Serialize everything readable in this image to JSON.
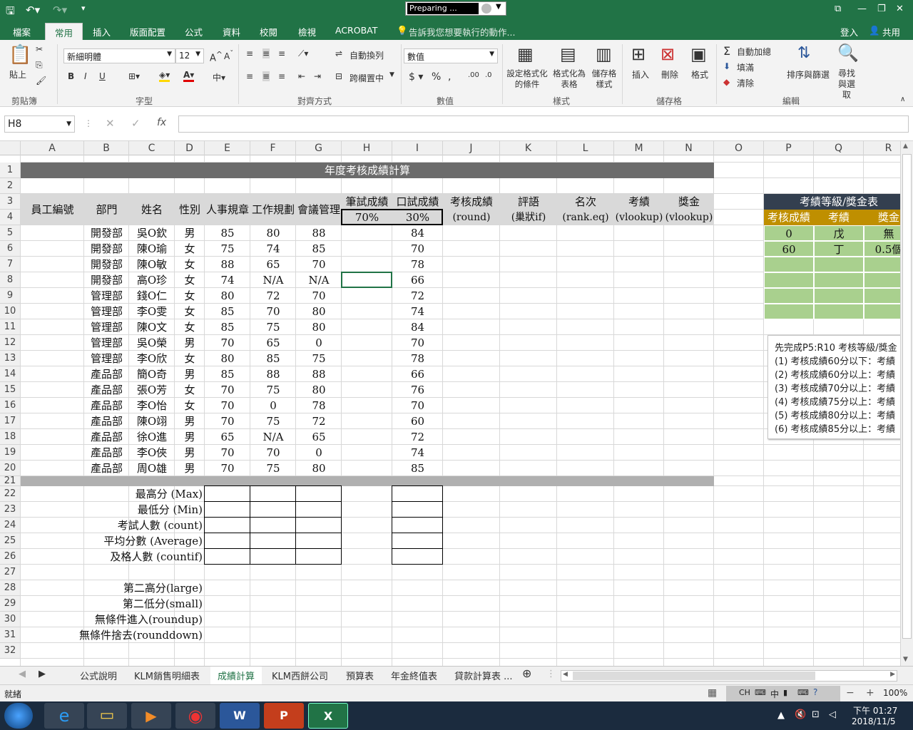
{
  "title_bar": {
    "preparing_text": "Preparing ...",
    "undo_icon": "undo-icon",
    "redo_icon": "redo-icon"
  },
  "ribbon_tabs": [
    "檔案",
    "常用",
    "插入",
    "版面配置",
    "公式",
    "資料",
    "校閱",
    "檢視",
    "ACROBAT"
  ],
  "tell_me": "告訴我您想要執行的動作...",
  "sign_in": "登入",
  "share": "共用",
  "ribbon": {
    "clipboard": {
      "paste": "貼上",
      "group": "剪貼簿"
    },
    "font": {
      "name": "新細明體",
      "size": "12",
      "group": "字型",
      "bold": "B",
      "italic": "I",
      "underline": "U"
    },
    "alignment": {
      "wrap": "自動換列",
      "merge": "跨欄置中",
      "group": "對齊方式"
    },
    "number": {
      "format": "數值",
      "group": "數值"
    },
    "styles": {
      "conditional": "設定格式化的條件",
      "table": "格式化為表格",
      "cell_styles": "儲存格樣式",
      "group": "樣式"
    },
    "cells": {
      "insert": "插入",
      "delete": "刪除",
      "format": "格式",
      "group": "儲存格"
    },
    "editing": {
      "autosum": "自動加總",
      "fill": "填滿",
      "clear": "清除",
      "sort": "排序與篩選",
      "find": "尋找與選取",
      "group": "編輯"
    }
  },
  "name_box": "H8",
  "formula_bar": {
    "fx": "fx",
    "content": ""
  },
  "columns": [
    "A",
    "B",
    "C",
    "D",
    "E",
    "F",
    "G",
    "H",
    "I",
    "J",
    "K",
    "L",
    "M",
    "N",
    "O",
    "P",
    "Q",
    "R"
  ],
  "rows": [
    "1",
    "2",
    "3",
    "4",
    "5",
    "6",
    "7",
    "8",
    "9",
    "10",
    "11",
    "12",
    "13",
    "14",
    "15",
    "16",
    "17",
    "18",
    "19",
    "20",
    "21",
    "22",
    "23",
    "24",
    "25",
    "26",
    "27",
    "28",
    "29",
    "30",
    "31",
    "32"
  ],
  "sheet_title": "年度考核成績計算",
  "headers": {
    "A": "員工編號",
    "B": "部門",
    "C": "姓名",
    "D": "性別",
    "E": "人事規章",
    "F": "工作規劃",
    "G": "會議管理",
    "H3": "筆試成績",
    "H4": "70%",
    "I3": "口試成績",
    "I4": "30%",
    "J3": "考核成績",
    "J4": "(round)",
    "K3": "評語",
    "K4": "(巢狀if)",
    "L3": "名次",
    "L4": "(rank.eq)",
    "M3": "考績",
    "M4": "(vlookup)",
    "N3": "獎金",
    "N4": "(vlookup)"
  },
  "employees": [
    {
      "dept": "開發部",
      "name": "吳O欽",
      "gender": "男",
      "e": "85",
      "f": "80",
      "g": "88",
      "i": "84"
    },
    {
      "dept": "開發部",
      "name": "陳O瑜",
      "gender": "女",
      "e": "75",
      "f": "74",
      "g": "85",
      "i": "70"
    },
    {
      "dept": "開發部",
      "name": "陳O敏",
      "gender": "女",
      "e": "88",
      "f": "65",
      "g": "70",
      "i": "78"
    },
    {
      "dept": "開發部",
      "name": "高O珍",
      "gender": "女",
      "e": "74",
      "f": "N/A",
      "g": "N/A",
      "i": "66"
    },
    {
      "dept": "管理部",
      "name": "錢O仁",
      "gender": "女",
      "e": "80",
      "f": "72",
      "g": "70",
      "i": "72"
    },
    {
      "dept": "管理部",
      "name": "李O雯",
      "gender": "女",
      "e": "85",
      "f": "70",
      "g": "80",
      "i": "74"
    },
    {
      "dept": "管理部",
      "name": "陳O文",
      "gender": "女",
      "e": "85",
      "f": "75",
      "g": "80",
      "i": "84"
    },
    {
      "dept": "管理部",
      "name": "吳O榮",
      "gender": "男",
      "e": "70",
      "f": "65",
      "g": "0",
      "i": "70"
    },
    {
      "dept": "管理部",
      "name": "李O欣",
      "gender": "女",
      "e": "80",
      "f": "85",
      "g": "75",
      "i": "78"
    },
    {
      "dept": "產品部",
      "name": "簡O奇",
      "gender": "男",
      "e": "85",
      "f": "88",
      "g": "88",
      "i": "66"
    },
    {
      "dept": "產品部",
      "name": "張O芳",
      "gender": "女",
      "e": "70",
      "f": "75",
      "g": "80",
      "i": "76"
    },
    {
      "dept": "產品部",
      "name": "李O怡",
      "gender": "女",
      "e": "70",
      "f": "0",
      "g": "78",
      "i": "70"
    },
    {
      "dept": "產品部",
      "name": "陳O翊",
      "gender": "男",
      "e": "70",
      "f": "75",
      "g": "72",
      "i": "60"
    },
    {
      "dept": "產品部",
      "name": "徐O進",
      "gender": "男",
      "e": "65",
      "f": "N/A",
      "g": "65",
      "i": "72"
    },
    {
      "dept": "產品部",
      "name": "李O俠",
      "gender": "男",
      "e": "70",
      "f": "70",
      "g": "0",
      "i": "74"
    },
    {
      "dept": "產品部",
      "name": "周O雄",
      "gender": "男",
      "e": "70",
      "f": "75",
      "g": "80",
      "i": "85"
    }
  ],
  "stats_labels": [
    "最高分 (Max)",
    "最低分 (Min)",
    "考試人數 (count)",
    "平均分數 (Average)",
    "及格人數 (countif)"
  ],
  "extra_labels": [
    "第二高分(large)",
    "第二低分(small)",
    "無條件進入(roundup)",
    "無條件捨去(rounddown)"
  ],
  "grade_table": {
    "title": "考績等級/獎金表",
    "headers": [
      "考核成績",
      "考績",
      "獎金"
    ],
    "rows": [
      [
        "0",
        "戊",
        "無"
      ],
      [
        "60",
        "丁",
        "0.5個"
      ]
    ]
  },
  "notes": [
    "先完成P5:R10 考核等級/獎金",
    "(1) 考核成績60分以下：考績",
    "(2) 考核成績60分以上：考績",
    "(3) 考核成績70分以上：考績",
    "(4) 考核成績75分以上：考績",
    "(5) 考核成績80分以上：考績",
    "(6) 考核成績85分以上：考績"
  ],
  "sheet_tabs": [
    "公式說明",
    "KLM銷售明細表",
    "成績計算",
    "KLM西餅公司",
    "預算表",
    "年金終值表",
    "貸款計算表 ..."
  ],
  "active_sheet": "成績計算",
  "status": {
    "ready": "就緒",
    "zoom": "100%"
  },
  "tray": {
    "lang": "CH",
    "ime": "中",
    "time": "下午 01:27",
    "date": "2018/11/5"
  },
  "colors": {
    "excel_green": "#217346",
    "title_band": "#6b6b6b",
    "header_gray": "#d9d9d9",
    "grade_green": "#a9d08e",
    "grade_gold": "#bf8f00",
    "grade_dark": "#333f4f"
  }
}
